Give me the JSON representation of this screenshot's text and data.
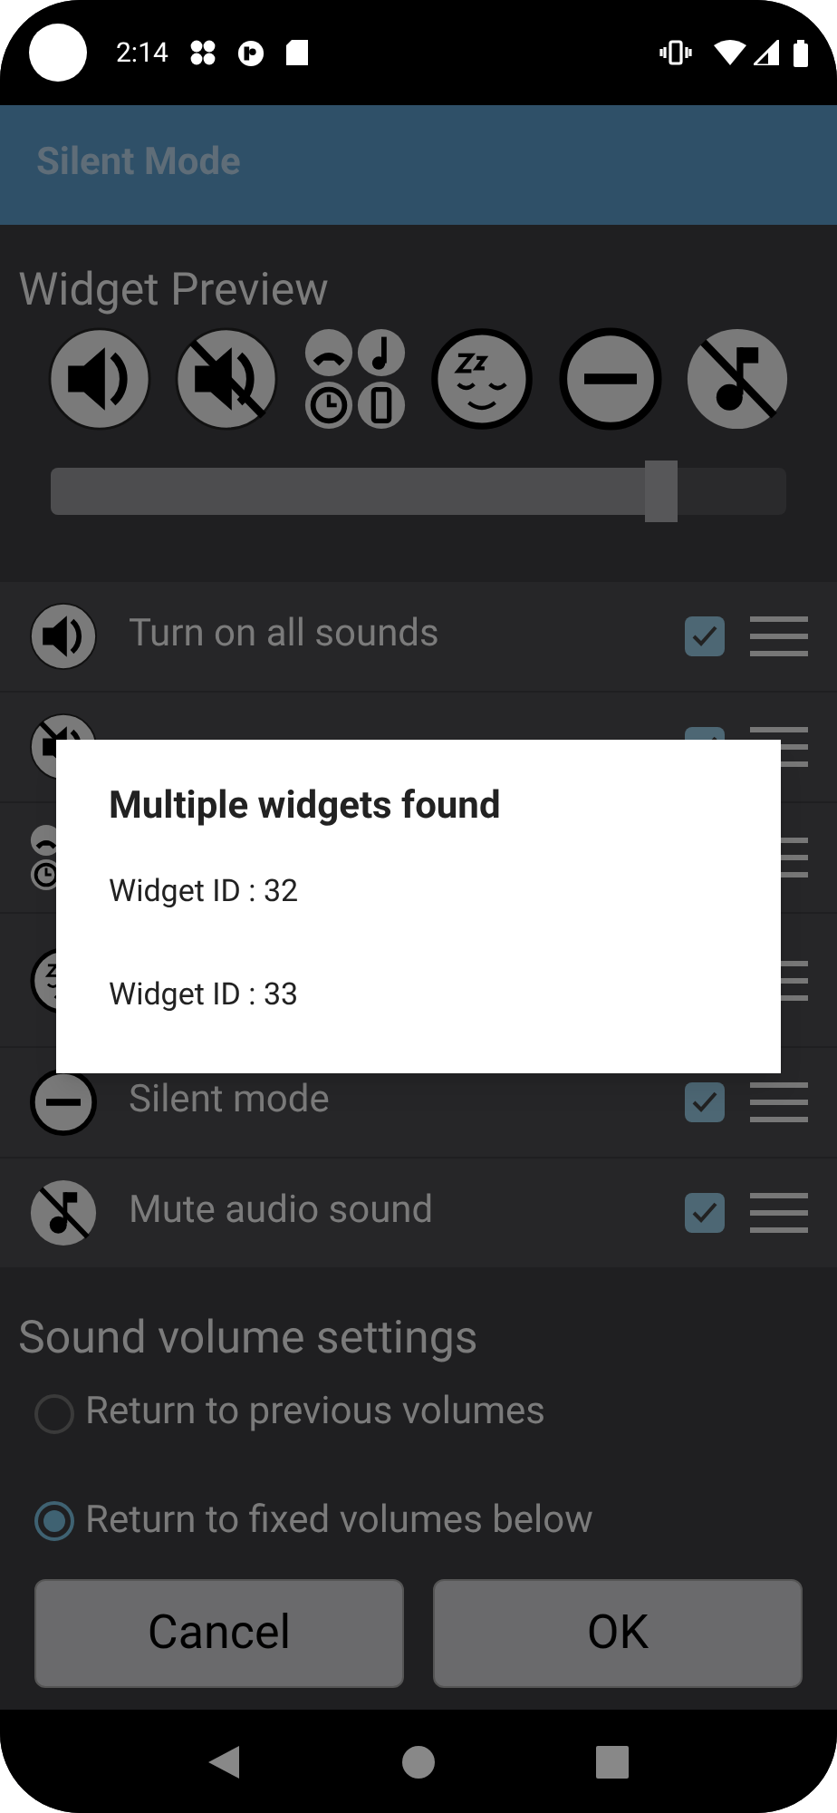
{
  "status_bar": {
    "time": "2:14"
  },
  "app_bar": {
    "title": "Silent Mode"
  },
  "widget_preview": {
    "title": "Widget Preview",
    "icons": [
      {
        "kind": "sound"
      },
      {
        "kind": "vibrate"
      },
      {
        "kind": "priority"
      },
      {
        "kind": "sleep"
      },
      {
        "kind": "silent"
      },
      {
        "kind": "mute"
      }
    ],
    "slider": {
      "level": 0.83
    }
  },
  "modes": [
    {
      "kind": "sound",
      "label": "Turn on all sounds",
      "checked": true
    },
    {
      "kind": "vibrate",
      "checked": true
    },
    {
      "kind": "priority"
    },
    {
      "kind": "sleep"
    },
    {
      "kind": "silent",
      "label": "Silent mode",
      "checked": true
    },
    {
      "kind": "mute",
      "label": "Mute audio sound",
      "checked": true
    }
  ],
  "sound_volume": {
    "title": "Sound volume settings",
    "options": [
      {
        "label": "Return to previous volumes",
        "selected": false
      },
      {
        "label": "Return to fixed volumes below",
        "selected": true
      }
    ]
  },
  "buttons": [
    "Cancel",
    "OK"
  ],
  "dialog": {
    "title": "Multiple widgets found",
    "items": [
      "Widget ID : 32",
      "Widget ID : 33"
    ]
  }
}
